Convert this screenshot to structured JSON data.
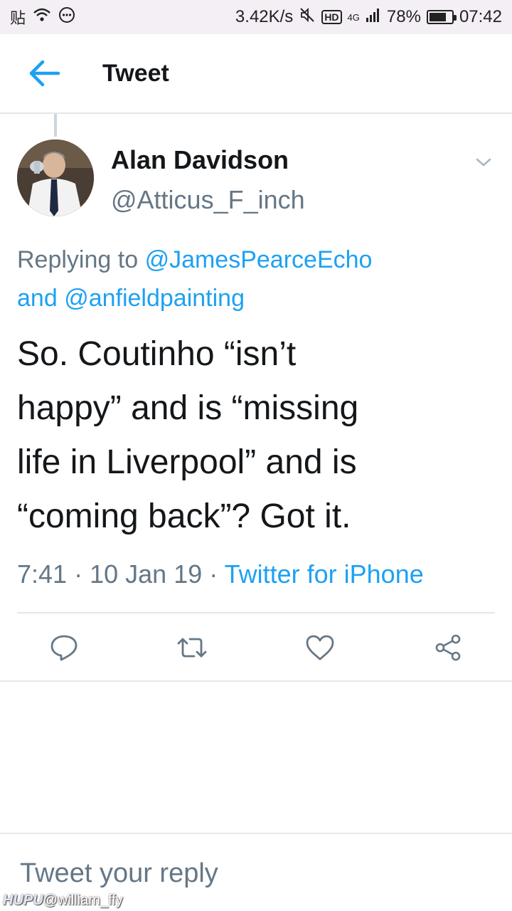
{
  "status_bar": {
    "left_glyph": "贴",
    "network_speed": "3.42K/s",
    "network_badge": "HD",
    "network_type": "4G",
    "battery_percent": "78%",
    "battery_level": 0.78,
    "time": "07:42"
  },
  "header": {
    "title": "Tweet"
  },
  "tweet": {
    "author_name": "Alan Davidson",
    "author_handle": "@Atticus_F_inch",
    "replying_prefix": "Replying to",
    "reply_mention_1": "@JamesPearceEcho",
    "reply_conjunction": "and",
    "reply_mention_2": "@anfieldpainting",
    "text": "So. Coutinho “isn’t\nhappy” and is  “missing\nlife in Liverpool” and is\n“coming back”?  Got it.",
    "time": "7:41",
    "date": "10 Jan 19",
    "separator": "·",
    "source": "Twitter for iPhone"
  },
  "reply_bar": {
    "placeholder": "Tweet your reply"
  },
  "watermark": {
    "brand": "HUPU",
    "handle": "@william_ffy"
  },
  "colors": {
    "accent": "#1da1f2",
    "secondary_text": "#657786",
    "primary_text": "#14171a",
    "divider": "#e1e8ed"
  }
}
